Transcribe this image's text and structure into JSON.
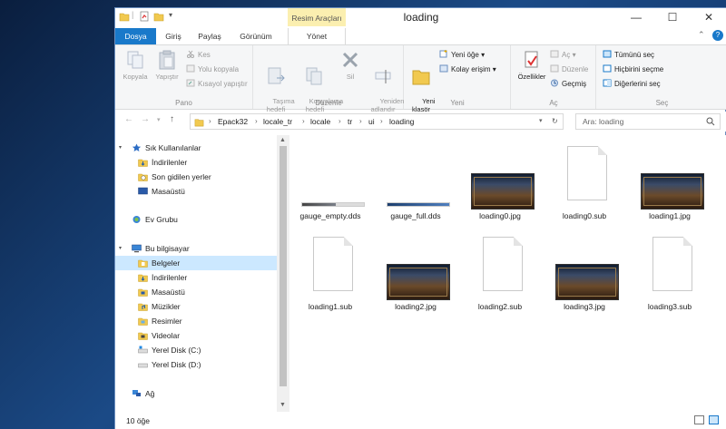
{
  "window": {
    "title": "loading"
  },
  "quick_access": {
    "dropdown_glyph": "▾"
  },
  "ribbon_tabs": {
    "file": "Dosya",
    "home": "Giriş",
    "share": "Paylaş",
    "view": "Görünüm",
    "picture_tools": "Resim Araçları",
    "manage": "Yönet"
  },
  "window_buttons": {
    "minimize": "—",
    "maximize": "☐",
    "close": "✕",
    "collapse": "⌃",
    "help": "?"
  },
  "ribbon": {
    "pano": {
      "label": "Pano",
      "copy": "Kopyala",
      "paste": "Yapıştır",
      "cut": "Kes",
      "copy_path": "Yolu kopyala",
      "paste_shortcut": "Kısayol yapıştır"
    },
    "duzenle": {
      "label": "Düzenle",
      "move_to": "Taşıma\nhedefi",
      "copy_to": "Kopyalama\nhedefi",
      "delete": "Sil",
      "rename": "Yeniden\nadlandır"
    },
    "yeni": {
      "label": "Yeni",
      "new_folder": "Yeni\nklasör",
      "new_item": "Yeni öğe",
      "easy_access": "Kolay erişim"
    },
    "ac": {
      "label": "Aç",
      "properties": "Özellikler",
      "open": "Aç",
      "edit": "Düzenle",
      "history": "Geçmiş"
    },
    "sec": {
      "label": "Seç",
      "select_all": "Tümünü seç",
      "select_none": "Hiçbirini seçme",
      "invert": "Diğerlerini seç"
    }
  },
  "address": {
    "breadcrumb": [
      "Epack32",
      "locale_tr",
      "locale",
      "tr",
      "ui",
      "loading"
    ],
    "separator": "›",
    "search_placeholder": "Ara: loading"
  },
  "nav": {
    "quick_access": "Sık Kullanılanlar",
    "downloads": "İndirilenler",
    "recent": "Son gidilen yerler",
    "desktop": "Masaüstü",
    "homegroup": "Ev Grubu",
    "this_pc": "Bu bilgisayar",
    "documents": "Belgeler",
    "downloads2": "İndirilenler",
    "desktop2": "Masaüstü",
    "music": "Müzikler",
    "pictures": "Resimler",
    "videos": "Videolar",
    "disk_c": "Yerel Disk (C:)",
    "disk_d": "Yerel Disk (D:)",
    "network": "Ağ"
  },
  "files": [
    {
      "name": "gauge_empty.dds",
      "kind": "gauge",
      "fill": 0.0
    },
    {
      "name": "gauge_full.dds",
      "kind": "gauge",
      "fill": 1.0
    },
    {
      "name": "loading0.jpg",
      "kind": "image"
    },
    {
      "name": "loading0.sub",
      "kind": "blank"
    },
    {
      "name": "loading1.jpg",
      "kind": "image"
    },
    {
      "name": "loading1.sub",
      "kind": "blank"
    },
    {
      "name": "loading2.jpg",
      "kind": "image"
    },
    {
      "name": "loading2.sub",
      "kind": "blank"
    },
    {
      "name": "loading3.jpg",
      "kind": "image"
    },
    {
      "name": "loading3.sub",
      "kind": "blank"
    }
  ],
  "status": {
    "count": "10 öğe"
  },
  "colors": {
    "accent": "#1979ca",
    "selection": "#cce8ff",
    "picture_tools": "#fbefb0"
  }
}
